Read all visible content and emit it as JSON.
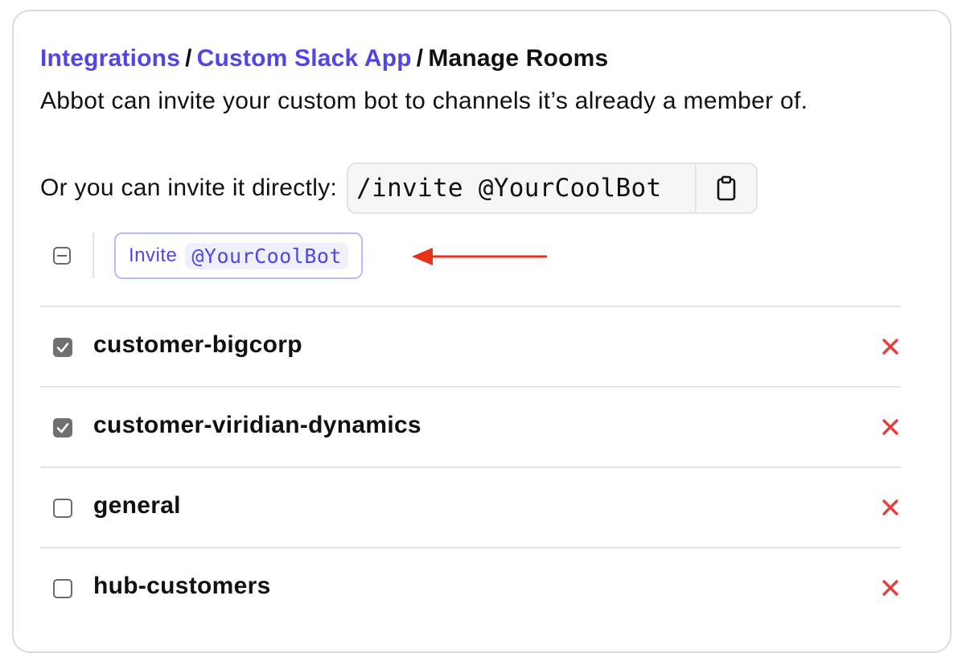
{
  "breadcrumb": {
    "items": [
      "Integrations",
      "Custom Slack App"
    ],
    "separator": "/",
    "current": "Manage Rooms"
  },
  "description": "Abbot can invite your custom bot to channels it’s already a member of.",
  "direct_invite": {
    "label": "Or you can invite it directly:",
    "command": "/invite @YourCoolBot",
    "copy_icon": "clipboard-icon"
  },
  "bulk_action": {
    "invite_label": "Invite",
    "bot_name": "@YourCoolBot",
    "annotation_icon": "arrow-left-icon"
  },
  "rooms": [
    {
      "name": "customer-bigcorp",
      "checked": true
    },
    {
      "name": "customer-viridian-dynamics",
      "checked": true
    },
    {
      "name": "general",
      "checked": false
    },
    {
      "name": "hub-customers",
      "checked": false
    }
  ],
  "colors": {
    "link": "#4f46e5",
    "remove": "#e53e3e",
    "annotation_arrow": "#e8311a"
  }
}
